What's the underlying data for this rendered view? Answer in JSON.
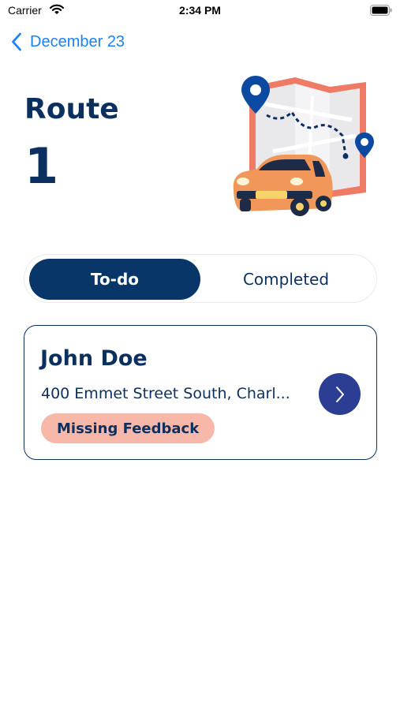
{
  "status_bar": {
    "carrier": "Carrier",
    "time": "2:34 PM"
  },
  "nav": {
    "back_label": "December 23"
  },
  "header": {
    "title": "Route",
    "route_number": "1"
  },
  "segments": {
    "todo_label": "To-do",
    "completed_label": "Completed",
    "selected": "To-do"
  },
  "stops": [
    {
      "name": "John Doe",
      "address": "400 Emmet Street South, Charl...",
      "badge": "Missing Feedback"
    }
  ],
  "colors": {
    "primary": "#083669",
    "text": "#0b2f5e",
    "link": "#1a82f7",
    "badge_bg": "#f7b8aa",
    "chevron_button": "#2c3e94",
    "car": "#f2975a",
    "map_border": "#ef7b67"
  },
  "icons": {
    "back": "chevron-left-icon",
    "open_stop": "chevron-right-icon",
    "wifi": "wifi-icon",
    "battery": "battery-icon"
  }
}
